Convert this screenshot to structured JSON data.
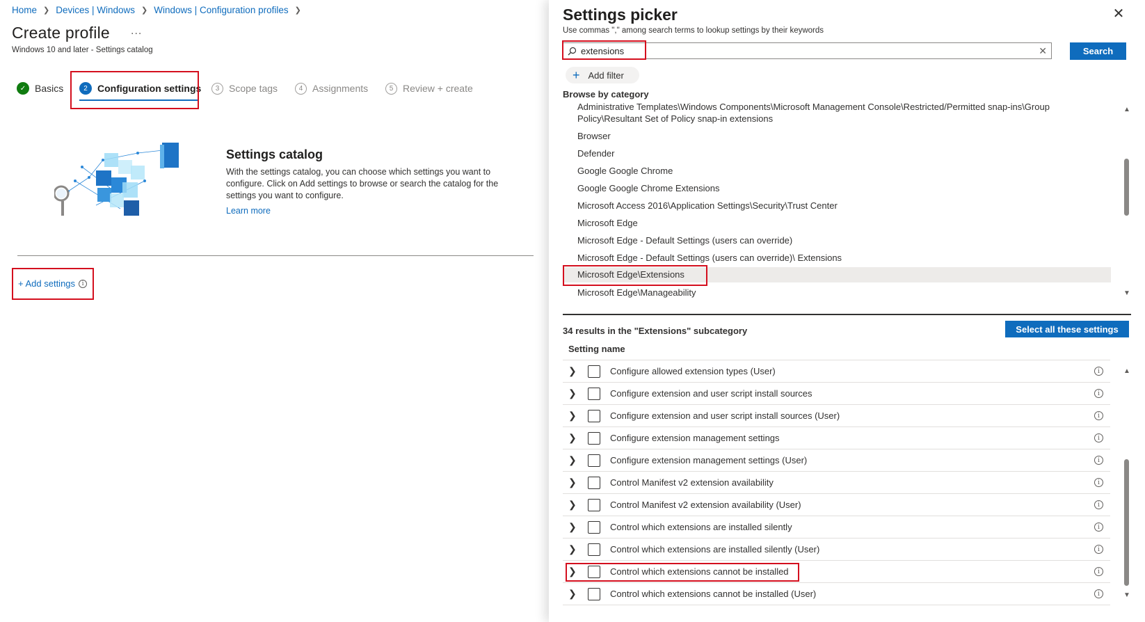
{
  "breadcrumb": [
    "Home",
    "Devices | Windows",
    "Windows | Configuration profiles"
  ],
  "page": {
    "title": "Create profile",
    "more": "...",
    "subtitle": "Windows 10 and later - Settings catalog"
  },
  "steps": [
    {
      "num": "✓",
      "label": "Basics",
      "state": "done"
    },
    {
      "num": "2",
      "label": "Configuration settings",
      "state": "active"
    },
    {
      "num": "3",
      "label": "Scope tags",
      "state": "future"
    },
    {
      "num": "4",
      "label": "Assignments",
      "state": "future"
    },
    {
      "num": "5",
      "label": "Review + create",
      "state": "future"
    }
  ],
  "catalog": {
    "title": "Settings catalog",
    "description": "With the settings catalog, you can choose which settings you want to configure. Click on Add settings to browse or search the catalog for the settings you want to configure.",
    "learn_more": "Learn more",
    "add_settings": "+ Add settings",
    "info_glyph": "i"
  },
  "picker": {
    "title": "Settings picker",
    "close": "✕",
    "subtitle": "Use commas \",\" among search terms to lookup settings by their keywords",
    "search_value": "extensions",
    "search_clear": "✕",
    "search_button": "Search",
    "add_filter": "Add filter",
    "add_filter_plus": "+",
    "browse_label": "Browse by category",
    "categories": [
      "Administrative Templates\\Windows Components\\Microsoft Management Console\\Restricted/Permitted snap-ins\\Group Policy\\Resultant Set of Policy snap-in extensions",
      "Browser",
      "Defender",
      "Google Google Chrome",
      "Google Google Chrome Extensions",
      "Microsoft Access 2016\\Application Settings\\Security\\Trust Center",
      "Microsoft Edge",
      "Microsoft Edge - Default Settings (users can override)",
      "Microsoft Edge - Default Settings (users can override)\\ Extensions",
      "Microsoft Edge\\Extensions",
      "Microsoft Edge\\Manageability"
    ],
    "selected_category_index": 9,
    "results_label": "34 results in the \"Extensions\" subcategory",
    "select_all": "Select all these settings",
    "column_header": "Setting name",
    "settings": [
      "Configure allowed extension types (User)",
      "Configure extension and user script install sources",
      "Configure extension and user script install sources (User)",
      "Configure extension management settings",
      "Configure extension management settings (User)",
      "Control Manifest v2 extension availability",
      "Control Manifest v2 extension availability (User)",
      "Control which extensions are installed silently",
      "Control which extensions are installed silently (User)",
      "Control which extensions cannot be installed",
      "Control which extensions cannot be installed (User)"
    ]
  },
  "colors": {
    "accent": "#0f6cbd",
    "highlight": "#d40f1e",
    "success": "#107c10"
  }
}
